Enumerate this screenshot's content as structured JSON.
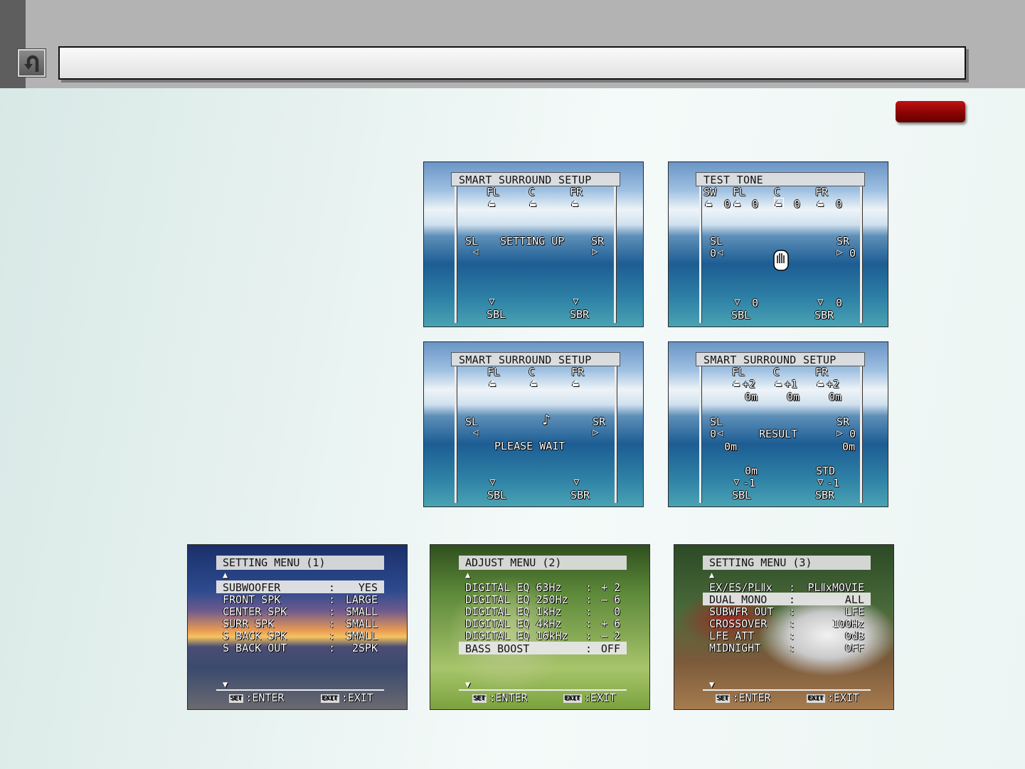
{
  "screens": {
    "setup": {
      "title": "SMART SURROUND SETUP",
      "fl": "FL",
      "c": "C",
      "fr": "FR",
      "sl": "SL",
      "sr": "SR",
      "sbl": "SBL",
      "sbr": "SBR",
      "status": "SETTING UP"
    },
    "test": {
      "title": "TEST TONE",
      "sw": "SW",
      "fl": "FL",
      "c": "C",
      "fr": "FR",
      "sw_val": "0",
      "fl_val": "0",
      "c_val": "0",
      "fr_val": "0",
      "sl": "SL",
      "sr": "SR",
      "sl_val": "0",
      "sr_val": "0",
      "sbl": "SBL",
      "sbr": "SBR",
      "sbl_val": "0",
      "sbr_val": "0"
    },
    "wait": {
      "title": "SMART SURROUND SETUP",
      "fl": "FL",
      "c": "C",
      "fr": "FR",
      "sl": "SL",
      "sr": "SR",
      "sbl": "SBL",
      "sbr": "SBR",
      "note": "♪",
      "status": "PLEASE WAIT"
    },
    "result": {
      "title": "SMART SURROUND SETUP",
      "fl": "FL",
      "c": "C",
      "fr": "FR",
      "fl_val": "+2",
      "c_val": "+1",
      "fr_val": "+2",
      "fl_dist": "0m",
      "c_dist": "0m",
      "fr_dist": "0m",
      "sl": "SL",
      "sr": "SR",
      "sl_val": "0",
      "sr_val": "0",
      "sl_dist": "0m",
      "sr_dist": "0m",
      "status": "RESULT",
      "sbl_dist": "0m",
      "sbr_dist": "STD",
      "sbl_val": "-1",
      "sbr_val": "-1",
      "sbl": "SBL",
      "sbr": "SBR"
    }
  },
  "menus": {
    "menu1": {
      "title": "SETTING MENU (1)",
      "rows": [
        {
          "k": "SUBWOOFER",
          "c": ":",
          "v": "YES"
        },
        {
          "k": "FRONT   SPK",
          "c": ":",
          "v": "LARGE"
        },
        {
          "k": "CENTER  SPK",
          "c": ":",
          "v": "SMALL"
        },
        {
          "k": "SURR    SPK",
          "c": ":",
          "v": "SMALL"
        },
        {
          "k": "S BACK  SPK",
          "c": ":",
          "v": "SMALL"
        },
        {
          "k": "S BACK  OUT",
          "c": ":",
          "v": "2SPK"
        }
      ],
      "enter": ":ENTER",
      "exit": ":EXIT"
    },
    "menu2": {
      "title": "ADJUST MENU (2)",
      "rows": [
        {
          "k": "DIGITAL EQ  63Hz",
          "c": ":",
          "v": "+ 2"
        },
        {
          "k": "DIGITAL EQ 250Hz",
          "c": ":",
          "v": "– 6"
        },
        {
          "k": "DIGITAL EQ  1kHz",
          "c": ":",
          "v": "0"
        },
        {
          "k": "DIGITAL EQ  4kHz",
          "c": ":",
          "v": "+ 6"
        },
        {
          "k": "DIGITAL EQ 16kHz",
          "c": ":",
          "v": "– 2"
        },
        {
          "k": "BASS BOOST",
          "c": ":",
          "v": "OFF"
        }
      ],
      "enter": ":ENTER",
      "exit": ":EXIT"
    },
    "menu3": {
      "title": "SETTING MENU (3)",
      "rows": [
        {
          "k": "EX/ES/PLⅡx",
          "c": ":",
          "v": "PLⅡxMOVIE"
        },
        {
          "k": "DUAL MONO",
          "c": ":",
          "v": "ALL"
        },
        {
          "k": "SUBWFR OUT",
          "c": ":",
          "v": "LFE"
        },
        {
          "k": "CROSSOVER",
          "c": ":",
          "v": "100Hz"
        },
        {
          "k": "LFE ATT",
          "c": ":",
          "v": "0dB"
        },
        {
          "k": "MIDNIGHT",
          "c": ":",
          "v": "OFF"
        }
      ],
      "enter": ":ENTER",
      "exit": ":EXIT"
    }
  },
  "keys": {
    "set": "SET",
    "exit": "EXIT"
  },
  "icons": {
    "back": "return-arrow-icon",
    "speaker_front": "speaker-front-icon",
    "speaker_side": "speaker-side-icon",
    "speaker_rear": "speaker-rear-icon",
    "hand": "hand-icon"
  },
  "colors": {
    "accent_red": "#9a0606",
    "header_gray": "#b3b3b3"
  }
}
